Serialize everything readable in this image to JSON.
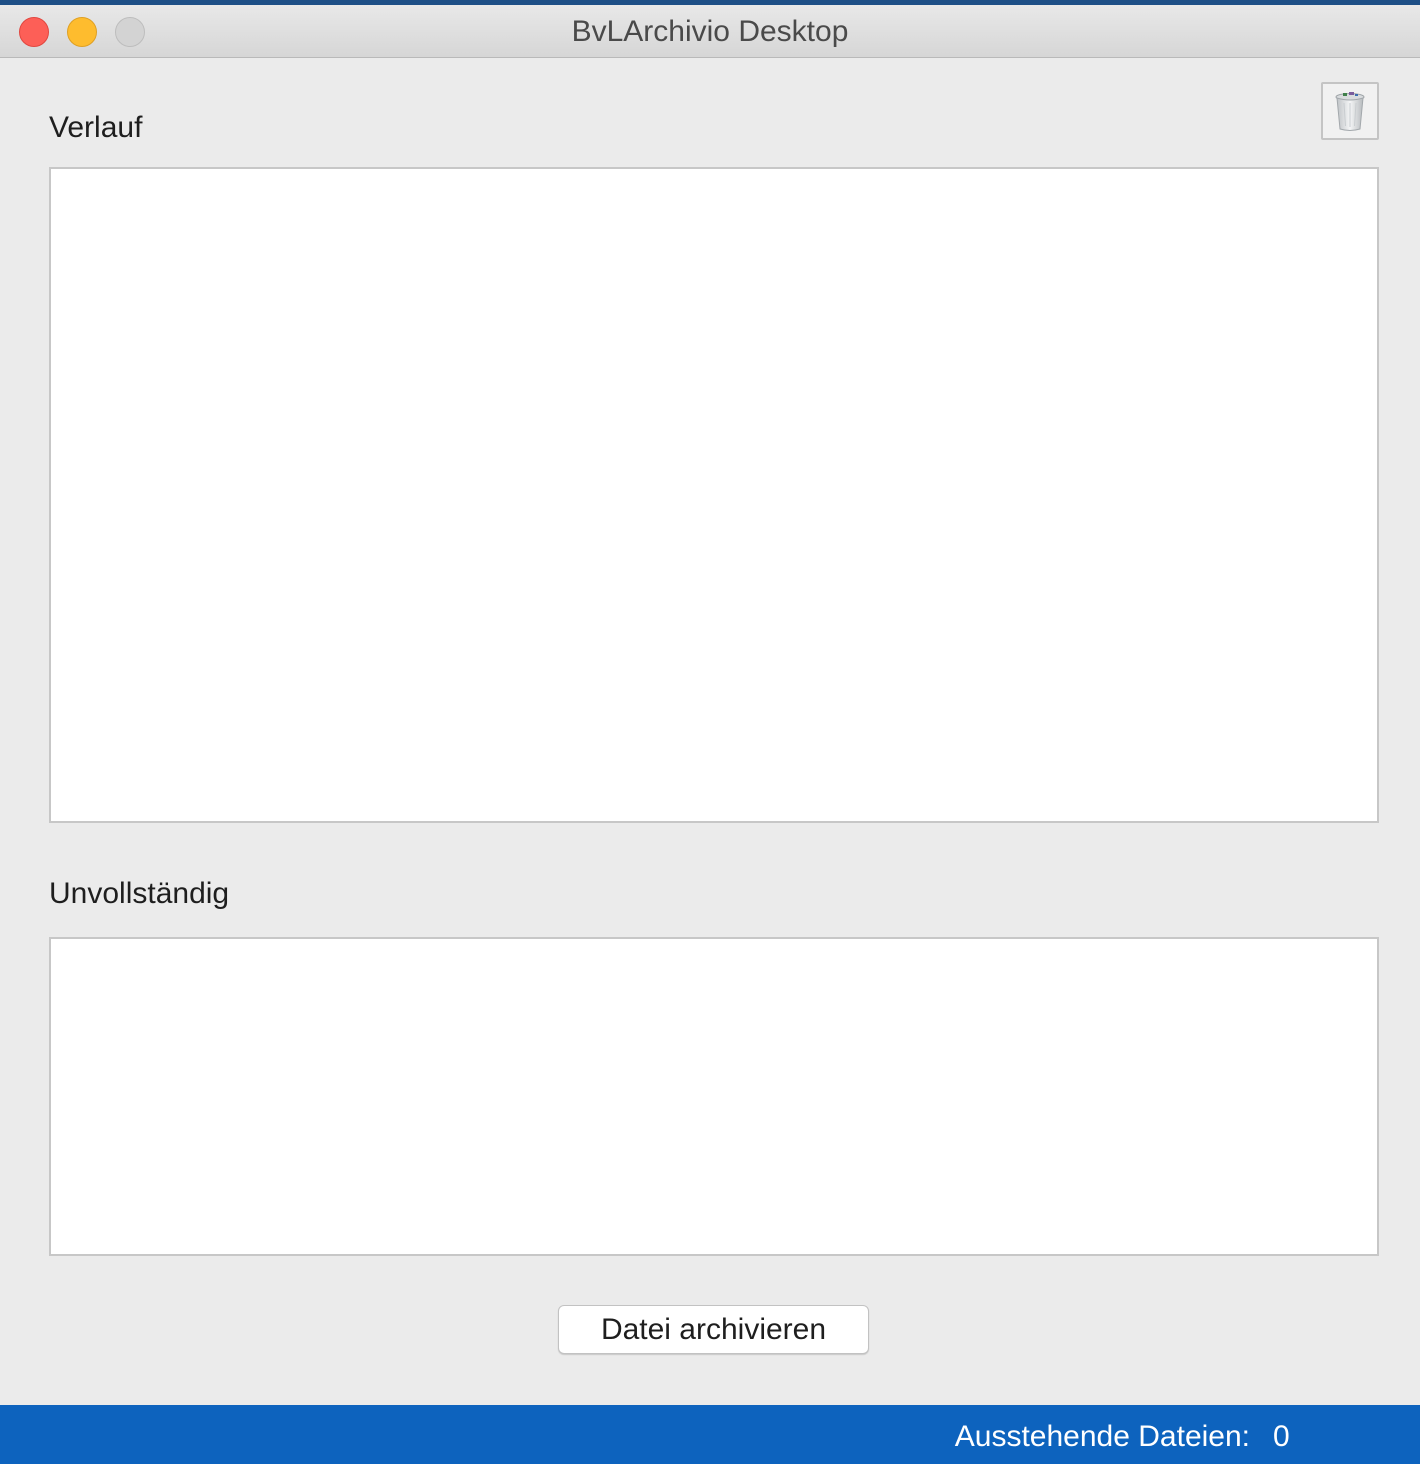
{
  "window": {
    "title": "BvLArchivio Desktop"
  },
  "sections": {
    "history_label": "Verlauf",
    "incomplete_label": "Unvollständig"
  },
  "lists": {
    "history_items": [],
    "incomplete_items": []
  },
  "toolbar": {
    "trash_icon": "trash-icon"
  },
  "actions": {
    "archive_label": "Datei archivieren"
  },
  "status": {
    "pending_label": "Ausstehende Dateien:",
    "pending_count": "0"
  },
  "colors": {
    "statusbar": "#0d63be",
    "close": "#fd5f57",
    "minimize": "#febc2e",
    "zoom": "#d3d3d3"
  }
}
